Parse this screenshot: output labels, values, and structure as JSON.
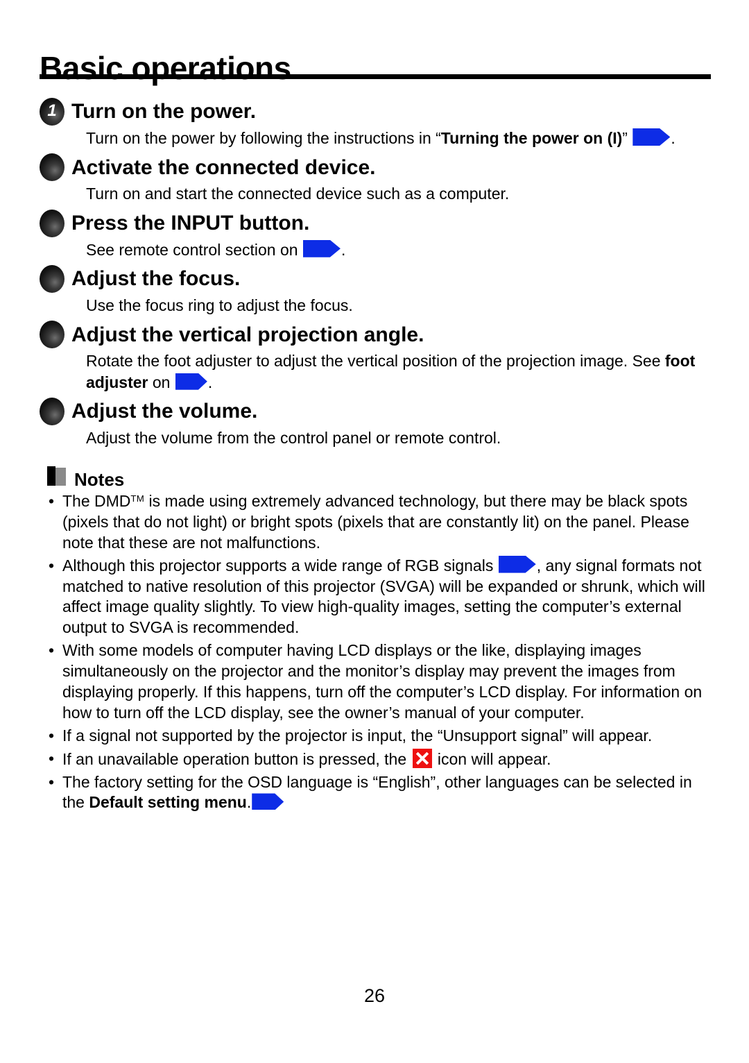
{
  "page": {
    "title": "Basic operations",
    "number": "26"
  },
  "icons": {
    "blue_arrow": "page-reference-arrow-icon",
    "red_x": "unavailable-operation-x-icon",
    "notes": "notes-pages-icon"
  },
  "colors": {
    "reference_arrow_blue": "#0D2CE6",
    "x_icon_red": "#EE1111",
    "notes_icon_gray": "#8A8A8A",
    "rule_black": "#000000"
  },
  "steps": [
    {
      "marker": "1",
      "title": "Turn on the power.",
      "body_parts": [
        {
          "text": "Turn on the power by following the instructions in “",
          "bold": false
        },
        {
          "text": "Turning the power on (I)",
          "bold": true
        },
        {
          "text": "” ",
          "bold": false
        },
        {
          "text": "",
          "arrow": true
        },
        {
          "text": ".",
          "bold": false
        }
      ]
    },
    {
      "marker": "",
      "title": "Activate the connected device.",
      "body_parts": [
        {
          "text": "Turn on and start the connected device such as a computer.",
          "bold": false
        }
      ]
    },
    {
      "marker": "",
      "title": "Press the INPUT button.",
      "body_parts": [
        {
          "text": "See remote control section on ",
          "bold": false
        },
        {
          "text": "",
          "arrow": true
        },
        {
          "text": ".",
          "bold": false
        }
      ]
    },
    {
      "marker": "",
      "title": "Adjust the focus.",
      "body_parts": [
        {
          "text": "Use the focus ring to adjust the focus.",
          "bold": false
        }
      ]
    },
    {
      "marker": "",
      "title": "Adjust the vertical projection angle.",
      "body_parts": [
        {
          "text": "Rotate the foot adjuster to adjust the vertical position of the projection image. See ",
          "bold": false
        },
        {
          "text": "foot adjuster",
          "bold": true
        },
        {
          "text": " on ",
          "bold": false
        },
        {
          "text": "",
          "arrow": true
        },
        {
          "text": ".",
          "bold": false
        }
      ]
    },
    {
      "marker": "",
      "title": "Adjust the volume.",
      "body_parts": [
        {
          "text": "Adjust the volume from the control panel or remote control.",
          "bold": false
        }
      ]
    }
  ],
  "notes": {
    "heading": "Notes",
    "bullet_char": "•",
    "items": [
      {
        "id": "note-dmd",
        "text_before_tm": "The DMD",
        "tm": "TM",
        "text_after_tm": " is made using extremely advanced technology, but there may be black spots (pixels that do not light) or bright spots (pixels that are constantly lit) on the panel. Please note that these are not malfunctions."
      },
      {
        "id": "note-rgb-signals",
        "text_a": "Although this projector supports a wide range of RGB signals ",
        "text_b": ", any signal formats not matched to native resolution of this projector (SVGA) will be expanded or shrunk, which will affect image quality slightly. To view high-quality images, setting the computer’s external output to SVGA is recommended."
      },
      {
        "id": "note-lcd-displays",
        "text": "With some models of computer having LCD displays or the like, displaying images simultaneously on the projector and the monitor’s display may prevent the images from displaying properly. If this happens, turn off the computer’s LCD display. For information on how to turn off the LCD display, see the owner’s manual of your computer."
      },
      {
        "id": "note-unsupport-signal",
        "text": "If a signal not supported by the projector is input, the “Unsupport signal” will appear."
      },
      {
        "id": "note-unavailable-button",
        "text_a": "If an unavailable operation button is pressed, the ",
        "text_b": " icon will appear."
      },
      {
        "id": "note-osd-language",
        "text_a": "The factory setting for the OSD language is “English”, other languages can be selected in the ",
        "text_b": "Default setting menu",
        "text_c": "."
      }
    ]
  }
}
